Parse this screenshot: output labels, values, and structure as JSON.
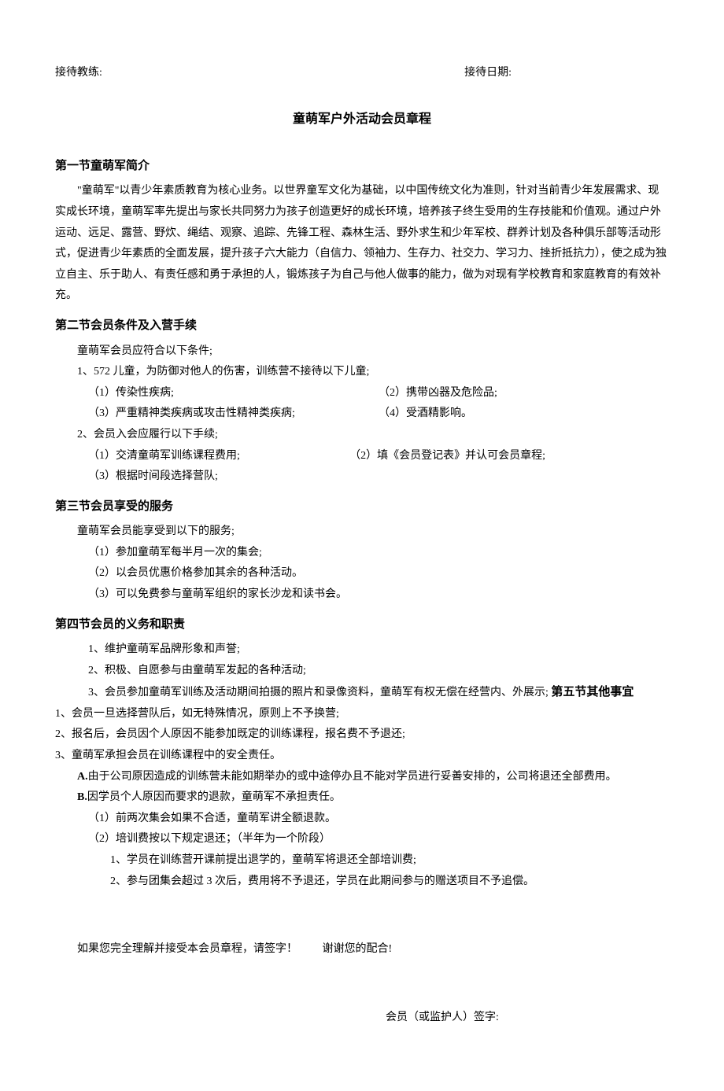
{
  "header": {
    "coach_label": "接待教练:",
    "date_label": "接待日期:"
  },
  "title": "童萌军户外活动会员章程",
  "section1": {
    "heading": "第一节童萌军简介",
    "body": "\"童萌军\"以青少年素质教育为核心业务。以世界童军文化为基础，以中国传统文化为准则，针对当前青少年发展需求、现实成长环境，童萌军率先提出与家长共同努力为孩子创造更好的成长环境，培养孩子终生受用的生存技能和价值观。通过户外运动、远足、露营、野炊、绳结、观察、追踪、先锋工程、森林生活、野外求生和少年军校、群养计划及各种俱乐部等活动形式，促进青少年素质的全面发展，提升孩子六大能力（自信力、领袖力、生存力、社交力、学习力、挫折抵抗力），使之成为独立自主、乐于助人、有责任感和勇于承担的人，锻炼孩子为自己与他人做事的能力，做为对现有学校教育和家庭教育的有效补充。"
  },
  "section2": {
    "heading": "第二节会员条件及入营手续",
    "intro": "童萌军会员应符合以下条件;",
    "item1": "1、572 儿童，为防御对他人的伤害，训练营不接待以下儿童;",
    "sub1a": "（1）传染性疾病;",
    "sub1b": "（2）携带凶器及危险品;",
    "sub1c": "（3）严重精神类疾病或攻击性精神类疾病;",
    "sub1d": "（4）受酒精影响。",
    "item2": "2、会员入会应履行以下手续;",
    "sub2a": "（1）交清童萌军训练课程费用;",
    "sub2b": "（2）填《会员登记表》并认可会员章程;",
    "sub2c": "（3）根据时间段选择营队;"
  },
  "section3": {
    "heading": "第三节会员享受的服务",
    "intro": "童萌军会员能享受到以下的服务;",
    "sub1": "（1）参加童萌军每半月一次的集会;",
    "sub2": "（2）以会员优惠价格参加其余的各种活动。",
    "sub3": "（3）可以免费参与童萌军组织的家长沙龙和读书会。"
  },
  "section4": {
    "heading": "第四节会员的义务和职责",
    "item1": "1、维护童萌军品牌形象和声誉;",
    "item2": "2、积极、自愿参与由童萌军发起的各种活动;",
    "item3_prefix": "3、会员参加童萌军训练及活动期间拍摄的照片和录像资料，童萌军有权无偿在经营内、外展示;",
    "section5_heading": "第五节其他事宜"
  },
  "section5": {
    "item1": "1、会员一旦选择营队后，如无特殊情况，原则上不予换营;",
    "item2": "2、报名后，会员因个人原因不能参加既定的训练课程，报名费不予退还;",
    "item3": "3、童萌军承担会员在训练课程中的安全责任。",
    "itemA": "A.由于公司原因造成的训练营未能如期举办的或中途停办且不能对学员进行妥善安排的，公司将退还全部费用。",
    "itemB": "B.因学员个人原因而要求的退款，童萌军不承担责任。",
    "subB1": "（1）前两次集会如果不合适，童萌军讲全额退款。",
    "subB2": "（2）培训费按以下规定退还；（半年为一个阶段）",
    "subB2_1": "1、学员在训练营开课前提出退学的，童萌军将退还全部培训费;",
    "subB2_2": "2、参与团集会超过 3 次后，费用将不予退还，学员在此期间参与的赠送项目不予追偿。"
  },
  "closing": {
    "line1_left": "如果您完全理解并接受本会员章程，请签字！",
    "line1_right": "谢谢您的配合!",
    "signature": "会员（或监护人）签字:"
  }
}
